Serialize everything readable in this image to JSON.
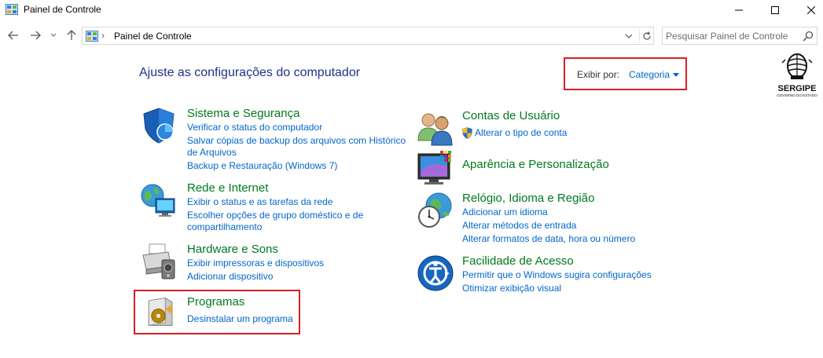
{
  "window": {
    "title": "Painel de Controle"
  },
  "address": {
    "separator": "›",
    "path": "Painel de Controle",
    "search_placeholder": "Pesquisar Painel de Controle"
  },
  "main": {
    "heading": "Ajuste as configurações do computador",
    "view_by": {
      "label": "Exibir por:",
      "value": "Categoria"
    },
    "logo_text": "SERGIPE",
    "logo_subtext": "GOVERNO DO ESTADO"
  },
  "categories": [
    {
      "title": "Sistema e Segurança",
      "links": [
        "Verificar o status do computador",
        "Salvar cópias de backup dos arquivos com Histórico",
        "de Arquivos",
        "Backup e Restauração (Windows 7)"
      ],
      "icon": "shield-icon"
    },
    {
      "title": "Rede e Internet",
      "links": [
        "Exibir o status e as tarefas da rede",
        "Escolher opções de grupo doméstico e de",
        "compartilhamento"
      ],
      "icon": "network-icon"
    },
    {
      "title": "Hardware e Sons",
      "links": [
        "Exibir impressoras e dispositivos",
        "Adicionar dispositivo"
      ],
      "icon": "printer-icon"
    },
    {
      "title": "Programas",
      "links": [
        "Desinstalar um programa"
      ],
      "icon": "programs-icon"
    },
    {
      "title": "Contas de Usuário",
      "links": [
        "Alterar o tipo de conta"
      ],
      "icon": "users-icon"
    },
    {
      "title": "Aparência e Personalização",
      "links": [],
      "icon": "appearance-icon"
    },
    {
      "title": "Relógio, Idioma e Região",
      "links": [
        "Adicionar um idioma",
        "Alterar métodos de entrada",
        "Alterar formatos de data, hora ou número"
      ],
      "icon": "clock-globe-icon"
    },
    {
      "title": "Facilidade de Acesso",
      "links": [
        "Permitir que o Windows sugira configurações",
        "Otimizar exibição visual"
      ],
      "icon": "ease-of-access-icon"
    }
  ],
  "colors": {
    "category_title": "#007a1e",
    "link": "#0066cc",
    "heading": "#1e3287",
    "highlight": "#d42027"
  }
}
